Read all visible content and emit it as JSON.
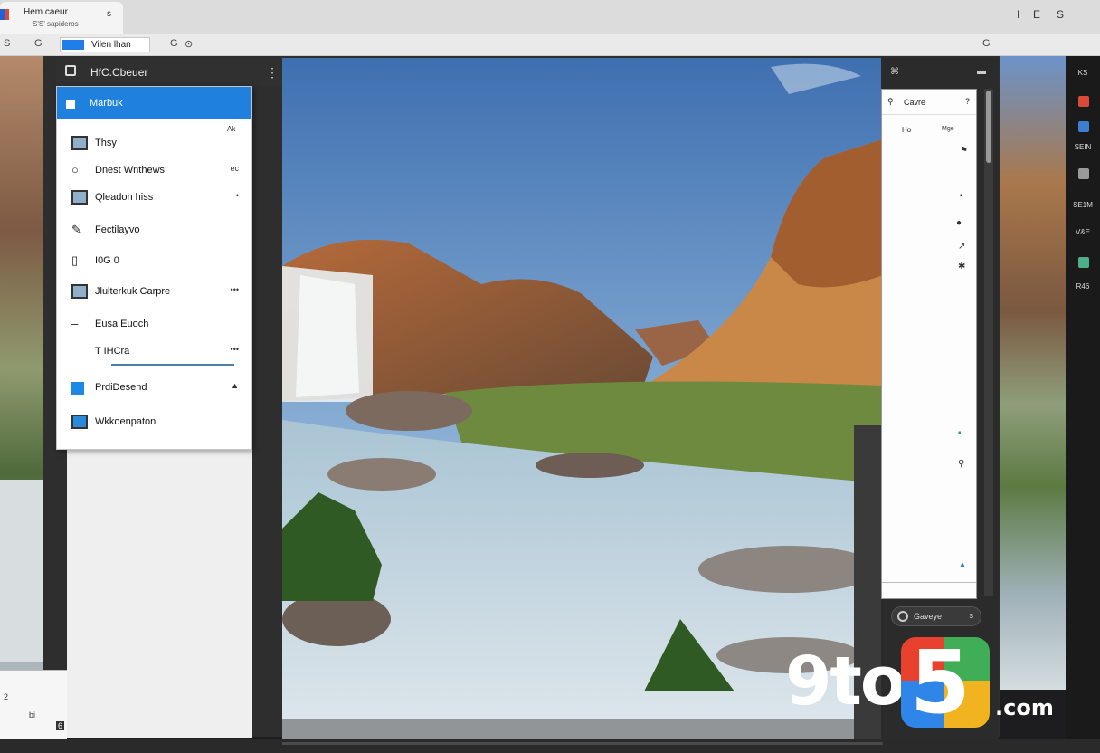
{
  "browser": {
    "tab_title": "Hem caeur",
    "tab_subtitle": "S'S' sapideros",
    "tab_close": "s",
    "window_controls": [
      "I",
      "E",
      "S"
    ],
    "toolbar_left": [
      "S",
      "G"
    ],
    "address_text": "Vilen lhan",
    "toolbar_glyphs": [
      "G",
      "⊙"
    ],
    "toolbar_right": "G"
  },
  "sidebar": {
    "title": "HfC.Cbeuer",
    "menu_icon": "⋮",
    "selected_item": "Marbuk",
    "hint": "Ak",
    "items": [
      {
        "label": "Thsy",
        "icon": "panel-icon",
        "accessory": ""
      },
      {
        "label": "Dnest Wnthews",
        "icon": "search-icon",
        "accessory": "ec"
      },
      {
        "label": "Qleadon hiss",
        "icon": "image-icon",
        "accessory": "•"
      },
      {
        "label": "Fectilayvo",
        "icon": "pen-icon",
        "accessory": ""
      },
      {
        "label": "I0G 0",
        "icon": "doc-icon",
        "accessory": ""
      },
      {
        "label": "Jlulterkuk Carpre",
        "icon": "folder-icon",
        "accessory": "•••"
      },
      {
        "label": "Eusa Euoch",
        "icon": "dash-icon",
        "accessory": ""
      },
      {
        "label": "T IHCra",
        "icon": "text-icon",
        "accessory": "•••"
      },
      {
        "label": "PrdiDesend",
        "icon": "square-icon",
        "accessory": "▲"
      },
      {
        "label": "Wkkoenpaton",
        "icon": "gallery-icon",
        "accessory": ""
      }
    ]
  },
  "right_panel": {
    "top_left": "⌘",
    "top_right": "▬",
    "list_title": "Cavre",
    "list_help": "?",
    "list_row": "Ho",
    "list_row_tag": "Mge",
    "footer_label": "Gaveye",
    "footer_close": "s"
  },
  "rail": {
    "labels": [
      "KS",
      "SEIN",
      "SE1M",
      "V&E",
      "R46"
    ],
    "colors": [
      "#d94a3a",
      "#3f7fcf",
      "#9a9a9a",
      "#4fae8a"
    ]
  },
  "left_bottom": [
    "2",
    "bi",
    "6",
    "•"
  ],
  "watermark": {
    "left": "9to",
    "five": "5",
    "suffix": ".com"
  }
}
